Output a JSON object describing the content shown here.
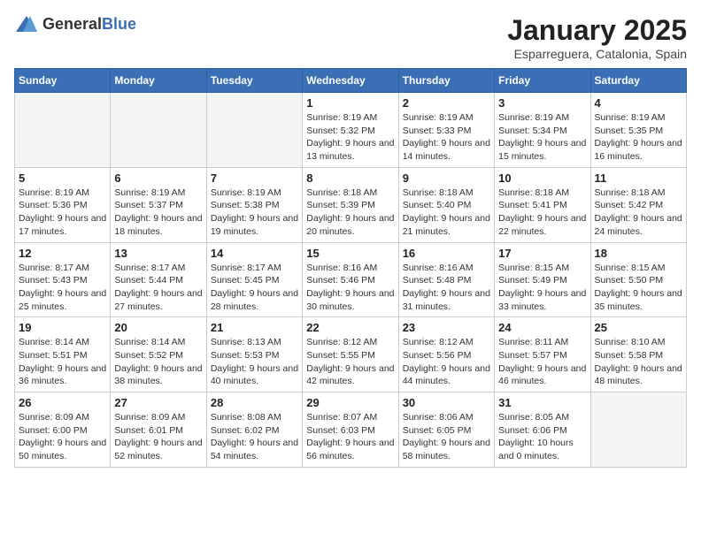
{
  "header": {
    "logo_general": "General",
    "logo_blue": "Blue",
    "title": "January 2025",
    "subtitle": "Esparreguera, Catalonia, Spain"
  },
  "calendar": {
    "weekdays": [
      "Sunday",
      "Monday",
      "Tuesday",
      "Wednesday",
      "Thursday",
      "Friday",
      "Saturday"
    ],
    "weeks": [
      [
        {
          "day": null
        },
        {
          "day": null
        },
        {
          "day": null
        },
        {
          "day": "1",
          "sunrise": "8:19 AM",
          "sunset": "5:32 PM",
          "daylight": "9 hours and 13 minutes."
        },
        {
          "day": "2",
          "sunrise": "8:19 AM",
          "sunset": "5:33 PM",
          "daylight": "9 hours and 14 minutes."
        },
        {
          "day": "3",
          "sunrise": "8:19 AM",
          "sunset": "5:34 PM",
          "daylight": "9 hours and 15 minutes."
        },
        {
          "day": "4",
          "sunrise": "8:19 AM",
          "sunset": "5:35 PM",
          "daylight": "9 hours and 16 minutes."
        }
      ],
      [
        {
          "day": "5",
          "sunrise": "8:19 AM",
          "sunset": "5:36 PM",
          "daylight": "9 hours and 17 minutes."
        },
        {
          "day": "6",
          "sunrise": "8:19 AM",
          "sunset": "5:37 PM",
          "daylight": "9 hours and 18 minutes."
        },
        {
          "day": "7",
          "sunrise": "8:19 AM",
          "sunset": "5:38 PM",
          "daylight": "9 hours and 19 minutes."
        },
        {
          "day": "8",
          "sunrise": "8:18 AM",
          "sunset": "5:39 PM",
          "daylight": "9 hours and 20 minutes."
        },
        {
          "day": "9",
          "sunrise": "8:18 AM",
          "sunset": "5:40 PM",
          "daylight": "9 hours and 21 minutes."
        },
        {
          "day": "10",
          "sunrise": "8:18 AM",
          "sunset": "5:41 PM",
          "daylight": "9 hours and 22 minutes."
        },
        {
          "day": "11",
          "sunrise": "8:18 AM",
          "sunset": "5:42 PM",
          "daylight": "9 hours and 24 minutes."
        }
      ],
      [
        {
          "day": "12",
          "sunrise": "8:17 AM",
          "sunset": "5:43 PM",
          "daylight": "9 hours and 25 minutes."
        },
        {
          "day": "13",
          "sunrise": "8:17 AM",
          "sunset": "5:44 PM",
          "daylight": "9 hours and 27 minutes."
        },
        {
          "day": "14",
          "sunrise": "8:17 AM",
          "sunset": "5:45 PM",
          "daylight": "9 hours and 28 minutes."
        },
        {
          "day": "15",
          "sunrise": "8:16 AM",
          "sunset": "5:46 PM",
          "daylight": "9 hours and 30 minutes."
        },
        {
          "day": "16",
          "sunrise": "8:16 AM",
          "sunset": "5:48 PM",
          "daylight": "9 hours and 31 minutes."
        },
        {
          "day": "17",
          "sunrise": "8:15 AM",
          "sunset": "5:49 PM",
          "daylight": "9 hours and 33 minutes."
        },
        {
          "day": "18",
          "sunrise": "8:15 AM",
          "sunset": "5:50 PM",
          "daylight": "9 hours and 35 minutes."
        }
      ],
      [
        {
          "day": "19",
          "sunrise": "8:14 AM",
          "sunset": "5:51 PM",
          "daylight": "9 hours and 36 minutes."
        },
        {
          "day": "20",
          "sunrise": "8:14 AM",
          "sunset": "5:52 PM",
          "daylight": "9 hours and 38 minutes."
        },
        {
          "day": "21",
          "sunrise": "8:13 AM",
          "sunset": "5:53 PM",
          "daylight": "9 hours and 40 minutes."
        },
        {
          "day": "22",
          "sunrise": "8:12 AM",
          "sunset": "5:55 PM",
          "daylight": "9 hours and 42 minutes."
        },
        {
          "day": "23",
          "sunrise": "8:12 AM",
          "sunset": "5:56 PM",
          "daylight": "9 hours and 44 minutes."
        },
        {
          "day": "24",
          "sunrise": "8:11 AM",
          "sunset": "5:57 PM",
          "daylight": "9 hours and 46 minutes."
        },
        {
          "day": "25",
          "sunrise": "8:10 AM",
          "sunset": "5:58 PM",
          "daylight": "9 hours and 48 minutes."
        }
      ],
      [
        {
          "day": "26",
          "sunrise": "8:09 AM",
          "sunset": "6:00 PM",
          "daylight": "9 hours and 50 minutes."
        },
        {
          "day": "27",
          "sunrise": "8:09 AM",
          "sunset": "6:01 PM",
          "daylight": "9 hours and 52 minutes."
        },
        {
          "day": "28",
          "sunrise": "8:08 AM",
          "sunset": "6:02 PM",
          "daylight": "9 hours and 54 minutes."
        },
        {
          "day": "29",
          "sunrise": "8:07 AM",
          "sunset": "6:03 PM",
          "daylight": "9 hours and 56 minutes."
        },
        {
          "day": "30",
          "sunrise": "8:06 AM",
          "sunset": "6:05 PM",
          "daylight": "9 hours and 58 minutes."
        },
        {
          "day": "31",
          "sunrise": "8:05 AM",
          "sunset": "6:06 PM",
          "daylight": "10 hours and 0 minutes."
        },
        {
          "day": null
        }
      ]
    ]
  }
}
